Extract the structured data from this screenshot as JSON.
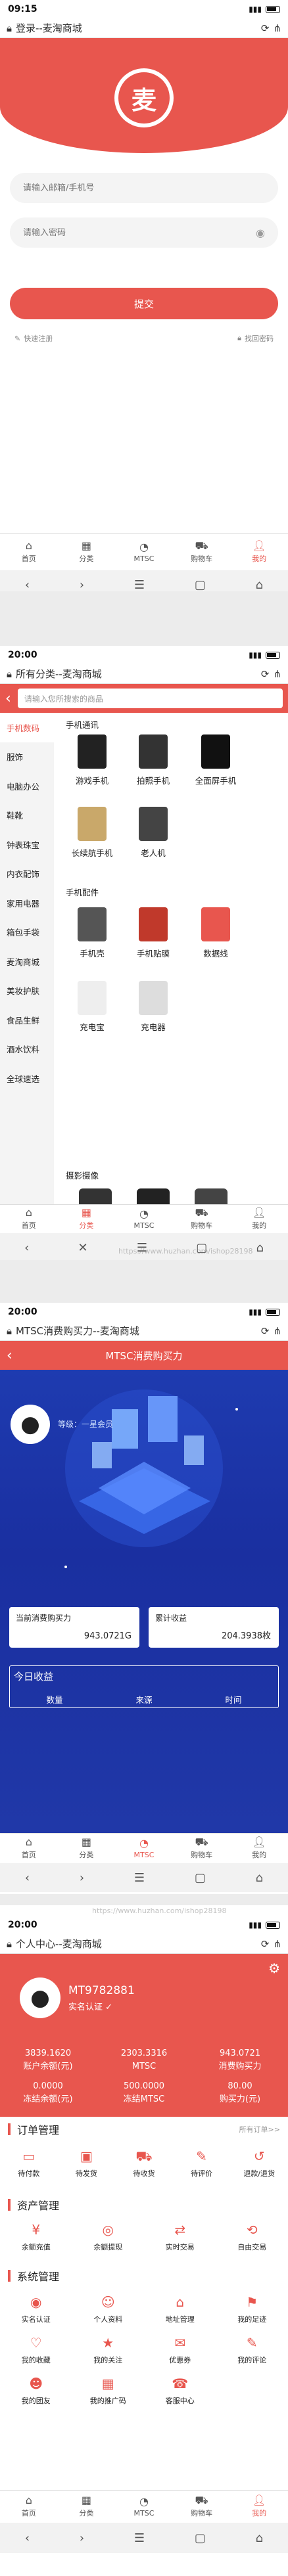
{
  "status": {
    "s1_time": "09:15",
    "s2_time": "20:00",
    "s3_time": "20:00",
    "s4_time": "20:00"
  },
  "screen1": {
    "url_title": "登录--麦淘商城",
    "logo_char": "麦",
    "email_placeholder": "请输入邮箱/手机号",
    "password_placeholder": "请输入密码",
    "login_label": "提交",
    "register_label": "快速注册",
    "forgot_label": "找回密码"
  },
  "screen2": {
    "url_title": "所有分类--麦淘商城",
    "search_placeholder": "请输入您所搜索的商品",
    "categories": [
      "手机数码",
      "服饰",
      "电脑办公",
      "鞋靴",
      "钟表珠宝",
      "内衣配饰",
      "家用电器",
      "箱包手袋",
      "麦淘商城",
      "美妆护肤",
      "食品生鲜",
      "酒水饮料",
      "全球速选"
    ],
    "sections": [
      {
        "title": "手机通讯",
        "items": [
          "游戏手机",
          "拍照手机",
          "全面屏手机",
          "长续航手机",
          "老人机"
        ]
      },
      {
        "title": "手机配件",
        "items": [
          "手机壳",
          "手机贴膜",
          "数据线",
          "充电宝",
          "充电器"
        ]
      },
      {
        "title": "摄影摄像",
        "items": []
      }
    ]
  },
  "screen3": {
    "url_title": "MTSC消费购买力--麦淘商城",
    "header_title": "MTSC消费购买力",
    "member_label": "等级：",
    "member_value": "一星会员",
    "current_power_label": "当前消费购买力",
    "current_power_value": "943.0721G",
    "cumulative_label": "累计收益",
    "cumulative_value": "204.3938枚",
    "today_label": "今日收益",
    "col_quantity": "数量",
    "col_source": "来源",
    "col_time": "时间"
  },
  "screen4": {
    "url_title": "个人中心--麦淘商城",
    "username": "MT9782881",
    "verified_label": "实名认证",
    "stats_row1": [
      {
        "value": "3839.1620",
        "label": "账户余额(元)"
      },
      {
        "value": "2303.3316",
        "label": "MTSC"
      },
      {
        "value": "943.0721",
        "label": "消费购买力"
      }
    ],
    "stats_row2": [
      {
        "value": "0.0000",
        "label": "冻结余额(元)"
      },
      {
        "value": "500.0000",
        "label": "冻结MTSC"
      },
      {
        "value": "80.00",
        "label": "购买力(元)"
      }
    ],
    "order_title": "订单管理",
    "order_more": "所有订单>>",
    "orders": [
      "待付款",
      "待发货",
      "待收货",
      "待评价",
      "退款/退货"
    ],
    "asset_title": "资产管理",
    "assets": [
      "余额充值",
      "余额提现",
      "实时交易",
      "自由交易"
    ],
    "system_title": "系统管理",
    "system_items": [
      "实名认证",
      "个人资料",
      "地址管理",
      "我的足迹",
      "我的收藏",
      "我的关注",
      "优惠券",
      "我的评论",
      "我的团友",
      "我的推广码",
      "客服中心"
    ]
  },
  "tabs": [
    "首页",
    "分类",
    "MTSC",
    "购物车",
    "我的"
  ],
  "watermark": "https://www.huzhan.com/ishop28198",
  "colors": {
    "accent": "#e8564e",
    "blue": "#1e3bb0"
  },
  "icons": [
    "lock-icon",
    "refresh-icon",
    "share-icon",
    "back-icon",
    "close-icon",
    "menu-icon",
    "tabs-icon",
    "home-icon",
    "eye-icon",
    "gear-icon"
  ]
}
